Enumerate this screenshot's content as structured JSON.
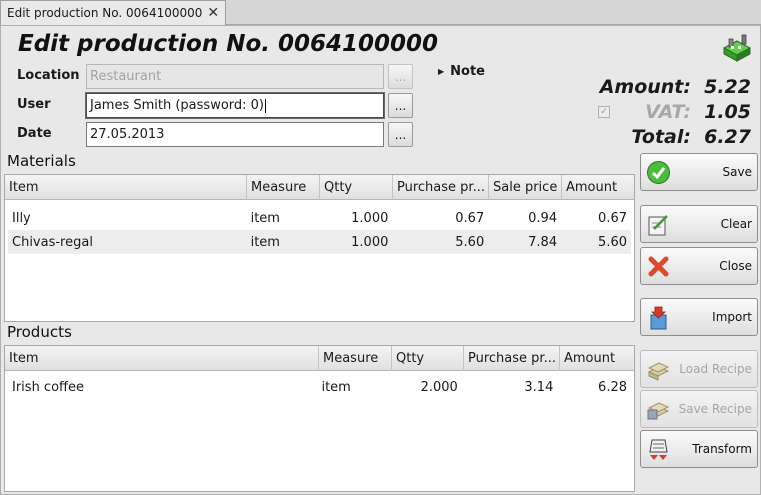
{
  "window": {
    "tab_title": "Edit production No. 0064100000",
    "tab_close": "✕"
  },
  "page": {
    "title": "Edit production No. 0064100000"
  },
  "form": {
    "location_label": "Location",
    "location_value": "Restaurant",
    "user_label": "User",
    "user_value": "James Smith (password: 0)",
    "date_label": "Date",
    "date_value": "27.05.2013",
    "dots": "...",
    "note_label": "Note"
  },
  "totals": {
    "amount_label": "Amount:",
    "amount_value": "5.22",
    "vat_label": "VAT:",
    "vat_value": "1.05",
    "vat_checked": true,
    "total_label": "Total:",
    "total_value": "6.27"
  },
  "materials": {
    "title": "Materials",
    "columns": [
      "Item",
      "Measure",
      "Qtty",
      "Purchase pr...",
      "Sale price",
      "Amount"
    ],
    "rows": [
      [
        "Illy",
        "item",
        "1.000",
        "0.67",
        "0.94",
        "0.67"
      ],
      [
        "Chivas-regal",
        "item",
        "1.000",
        "5.60",
        "7.84",
        "5.60"
      ]
    ]
  },
  "products": {
    "title": "Products",
    "columns": [
      "Item",
      "Measure",
      "Qtty",
      "Purchase pr...",
      "Amount"
    ],
    "rows": [
      [
        "Irish coffee",
        "item",
        "2.000",
        "3.14",
        "6.28"
      ]
    ]
  },
  "buttons": {
    "save": "Save",
    "clear": "Clear",
    "close": "Close",
    "import": "Import",
    "load_recipe": "Load Recipe",
    "save_recipe": "Save Recipe",
    "transform": "Transform"
  },
  "colors": {
    "accent_green": "#3aa83a",
    "close_red": "#d83a20",
    "disabled_text": "#a6a6a6"
  }
}
